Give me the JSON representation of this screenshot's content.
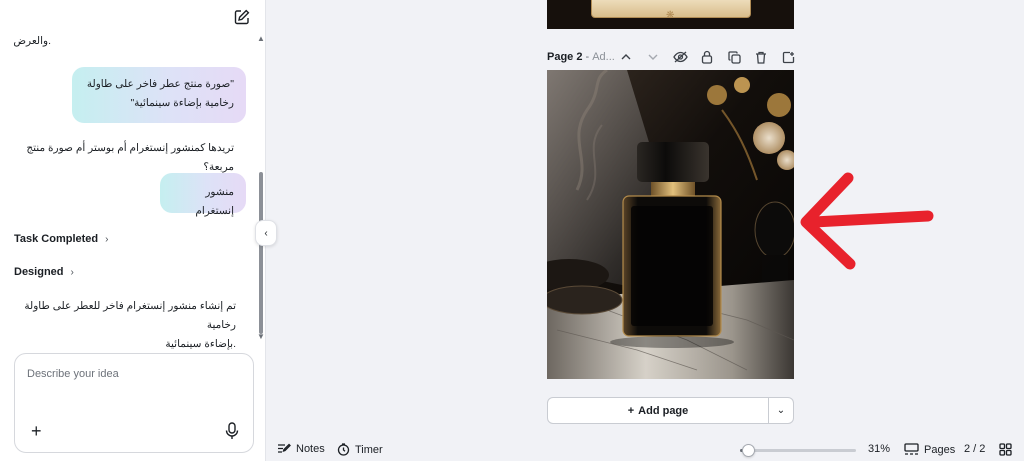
{
  "chat": {
    "messages": [
      {
        "role": "assistant",
        "text": ".والعرض"
      },
      {
        "role": "user",
        "lines": [
          "\"صورة منتج عطر فاخر على طاولة",
          "رخامية بإضاءة سينمائية\""
        ]
      },
      {
        "role": "assistant",
        "text": "تريدها كمنشور إنستغرام أم بوستر أم صورة منتج مربعة؟"
      },
      {
        "role": "user",
        "text": "منشور إنستغرام"
      }
    ],
    "task_completed_label": "Task Completed",
    "designed_label": "Designed",
    "result_lines": [
      "تم إنشاء منشور إنستغرام فاخر للعطر على طاولة رخامية",
      ".بإضاءة سينمائية"
    ],
    "input_placeholder": "Describe your idea"
  },
  "page": {
    "label": "Page 2",
    "separator": " - ",
    "subtitle": "Ad...",
    "add_page_label": "Add page"
  },
  "bottombar": {
    "notes_label": "Notes",
    "timer_label": "Timer",
    "zoom_percent": 31,
    "zoom_label": "31%",
    "pages_label": "Pages",
    "page_counter": "2 / 2"
  },
  "colors": {
    "accent_arrow": "#e8222c",
    "bubble_gradient": [
      "#c5eff0",
      "#e6daf6"
    ]
  }
}
